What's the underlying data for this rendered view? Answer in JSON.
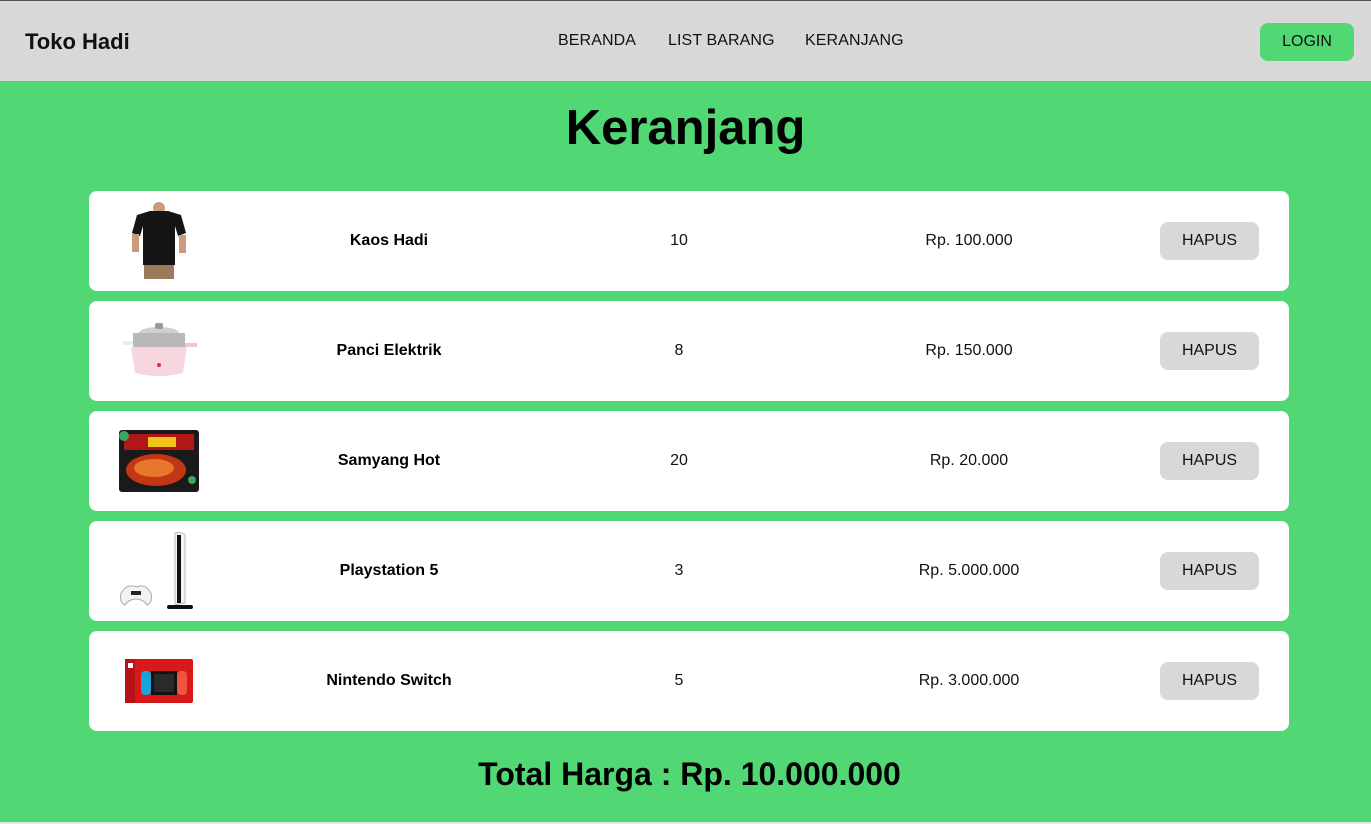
{
  "navbar": {
    "brand": "Toko Hadi",
    "links": [
      "BERANDA",
      "LIST BARANG",
      "KERANJANG"
    ],
    "login_label": "LOGIN"
  },
  "page": {
    "title": "Keranjang"
  },
  "cart": {
    "items": [
      {
        "name": "Kaos Hadi",
        "qty": "10",
        "price": "Rp. 100.000",
        "action": "HAPUS",
        "image": "black-tshirt"
      },
      {
        "name": "Panci Elektrik",
        "qty": "8",
        "price": "Rp. 150.000",
        "action": "HAPUS",
        "image": "electric-pot"
      },
      {
        "name": "Samyang Hot",
        "qty": "20",
        "price": "Rp. 20.000",
        "action": "HAPUS",
        "image": "noodle-pack"
      },
      {
        "name": "Playstation 5",
        "qty": "3",
        "price": "Rp. 5.000.000",
        "action": "HAPUS",
        "image": "ps5-console"
      },
      {
        "name": "Nintendo Switch",
        "qty": "5",
        "price": "Rp. 3.000.000",
        "action": "HAPUS",
        "image": "switch-box"
      }
    ],
    "total_label": "Total Harga : Rp. 10.000.000"
  },
  "colors": {
    "brand_green": "#51d774",
    "navbar_bg": "#d8d8d8",
    "button_gray": "#d8d8d8",
    "card_bg": "#ffffff"
  }
}
